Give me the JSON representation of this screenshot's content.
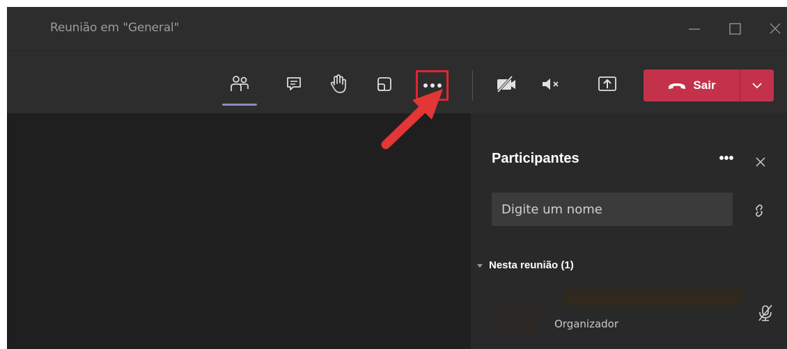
{
  "window": {
    "title": "Reunião em \"General\""
  },
  "toolbar": {
    "icons": {
      "participants": "people-icon",
      "chat": "chat-icon",
      "raise_hand": "raise-hand-icon",
      "rooms": "rooms-icon",
      "more": "more-options-icon",
      "camera": "camera-off-icon",
      "mic": "mic-muted-icon",
      "share": "share-screen-icon"
    },
    "active_tab": "participants",
    "leave_label": "Sair"
  },
  "panel": {
    "title": "Participantes",
    "more": "•••",
    "search_placeholder": "Digite um nome",
    "section_label": "Nesta reunião (1)",
    "participants": [
      {
        "role": "Organizador",
        "muted": true
      }
    ]
  },
  "colors": {
    "background": "#1f1f1f",
    "toolbar": "#2d2d2d",
    "panel": "#292929",
    "leave_button": "#c4314b",
    "active_tab_indicator": "#8b8cc7",
    "highlight": "#e3242f"
  }
}
